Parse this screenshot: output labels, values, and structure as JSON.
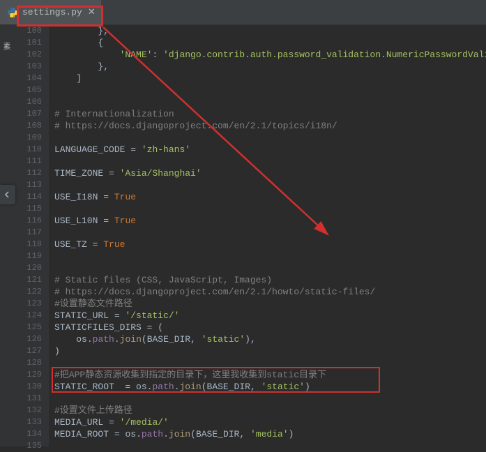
{
  "tab": {
    "filename": "settings.py",
    "close": "✕"
  },
  "left_gutter": "素",
  "lines": [
    {
      "n": 100,
      "html": "        <span class='op'>},</span>"
    },
    {
      "n": 101,
      "html": "        <span class='op'>{</span>"
    },
    {
      "n": 102,
      "html": "            <span class='str'>'NAME'</span><span class='op'>: </span><span class='str'>'django.contrib.auth.password_validation.NumericPasswordValid</span>"
    },
    {
      "n": 103,
      "html": "        <span class='op'>},</span>"
    },
    {
      "n": 104,
      "html": "    <span class='op'>]</span>"
    },
    {
      "n": 105,
      "html": ""
    },
    {
      "n": 106,
      "html": ""
    },
    {
      "n": 107,
      "html": "<span class='cm'># Internationalization</span>"
    },
    {
      "n": 108,
      "html": "<span class='cm'># https://docs.djangoproject.com/en/2.1/topics/i18n/</span>"
    },
    {
      "n": 109,
      "html": ""
    },
    {
      "n": 110,
      "html": "<span class='nm'>LANGUAGE_CODE </span><span class='op'>=</span> <span class='str'>'zh-hans'</span>"
    },
    {
      "n": 111,
      "html": ""
    },
    {
      "n": 112,
      "html": "<span class='nm'>TIME_ZONE </span><span class='op'>=</span> <span class='str'>'Asia/Shanghai'</span>"
    },
    {
      "n": 113,
      "html": ""
    },
    {
      "n": 114,
      "html": "<span class='nm'>USE_I18N </span><span class='op'>=</span> <span class='bool'>True</span>"
    },
    {
      "n": 115,
      "html": ""
    },
    {
      "n": 116,
      "html": "<span class='nm'>USE_L10N </span><span class='op'>=</span> <span class='bool'>True</span>"
    },
    {
      "n": 117,
      "html": ""
    },
    {
      "n": 118,
      "html": "<span class='nm'>USE_TZ </span><span class='op'>=</span> <span class='bool'>True</span>"
    },
    {
      "n": 119,
      "html": ""
    },
    {
      "n": 120,
      "html": ""
    },
    {
      "n": 121,
      "html": "<span class='cm'># Static files (CSS, JavaScript, Images)</span>"
    },
    {
      "n": 122,
      "html": "<span class='cm'># https://docs.djangoproject.com/en/2.1/howto/static-files/</span>"
    },
    {
      "n": 123,
      "html": "<span class='cm'>#设置静态文件路径</span>"
    },
    {
      "n": 124,
      "html": "<span class='nm'>STATIC_URL </span><span class='op'>=</span> <span class='str'>'/static/'</span>"
    },
    {
      "n": 125,
      "html": "<span class='nm'>STATICFILES_DIRS </span><span class='op'>= (</span>"
    },
    {
      "n": 126,
      "html": "    <span class='nm'>os</span><span class='op'>.</span><span class='attr'>path</span><span class='op'>.</span><span class='fn'>join</span><span class='op'>(</span><span class='nm'>BASE_DIR</span><span class='op'>, </span><span class='str'>'static'</span><span class='op'>),</span>"
    },
    {
      "n": 127,
      "html": "<span class='op'>)</span>"
    },
    {
      "n": 128,
      "html": ""
    },
    {
      "n": 129,
      "html": "<span class='cm'>#把APP静态资源收集到指定的目录下，这里我收集到static目录下</span>"
    },
    {
      "n": 130,
      "html": "<span class='nm'>STATIC_ROOT  </span><span class='op'>=</span> <span class='nm'>os</span><span class='op'>.</span><span class='attr'>path</span><span class='op'>.</span><span class='fn'>join</span><span class='op'>(</span><span class='nm'>BASE_DIR</span><span class='op'>, </span><span class='str'>'static'</span><span class='op'>)</span>"
    },
    {
      "n": 131,
      "html": ""
    },
    {
      "n": 132,
      "html": "<span class='cm'>#设置文件上传路径</span>"
    },
    {
      "n": 133,
      "html": "<span class='nm'>MEDIA_URL </span><span class='op'>=</span> <span class='str'>'/media/'</span>"
    },
    {
      "n": 134,
      "html": "<span class='nm'>MEDIA_ROOT </span><span class='op'>=</span> <span class='nm'>os</span><span class='op'>.</span><span class='attr'>path</span><span class='op'>.</span><span class='fn'>join</span><span class='op'>(</span><span class='nm'>BASE_DIR</span><span class='op'>, </span><span class='str'>'media'</span><span class='op'>)</span>"
    },
    {
      "n": 135,
      "html": ""
    }
  ]
}
